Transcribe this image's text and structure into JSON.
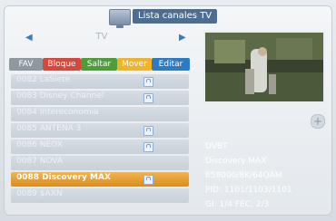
{
  "window": {
    "title": "Lista canales TV"
  },
  "selector": {
    "label": "TV"
  },
  "tabs": [
    {
      "label": "FAV",
      "color": "#8f989f"
    },
    {
      "label": "Bloque",
      "color": "#d8473a"
    },
    {
      "label": "Saltar",
      "color": "#4d9e3b"
    },
    {
      "label": "Mover",
      "color": "#f0b32b"
    },
    {
      "label": "Editar",
      "color": "#2c7bc4"
    }
  ],
  "channels": [
    {
      "name": "0082 LaSiete",
      "locked": true
    },
    {
      "name": "0083 Disney Channel",
      "locked": true
    },
    {
      "name": "0084 Intereconomia",
      "locked": false
    },
    {
      "name": "0085 ANTENA 3",
      "locked": true
    },
    {
      "name": "0086 NEOX",
      "locked": true
    },
    {
      "name": "0087 NOVA",
      "locked": false
    },
    {
      "name": "0088 Discovery MAX",
      "locked": true,
      "selected": true
    },
    {
      "name": "0089 $AXN",
      "locked": false
    }
  ],
  "info": {
    "system": "DVBT",
    "channel": "Discovery MAX",
    "params": "858000/8K/64QAM",
    "pid": "PID: 1101/1103/1101",
    "gi": "GI: 1/4  FEC: 2/3"
  }
}
